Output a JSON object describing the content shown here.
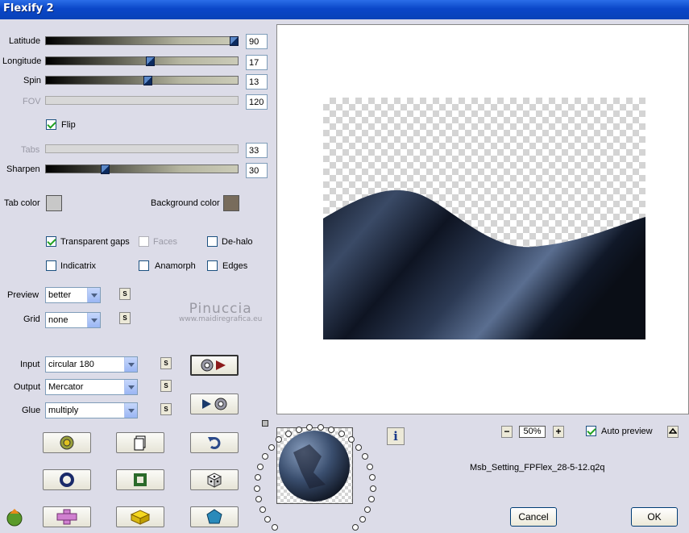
{
  "window": {
    "title": "Flexify 2"
  },
  "sliders": {
    "latitude": {
      "label": "Latitude",
      "value": "90",
      "level": 0.97,
      "enabled": true
    },
    "longitude": {
      "label": "Longitude",
      "value": "17",
      "level": 0.54,
      "enabled": true
    },
    "spin": {
      "label": "Spin",
      "value": "13",
      "level": 0.53,
      "enabled": true
    },
    "fov": {
      "label": "FOV",
      "value": "120",
      "enabled": false
    },
    "tabs": {
      "label": "Tabs",
      "value": "33",
      "enabled": false
    },
    "sharpen": {
      "label": "Sharpen",
      "value": "30",
      "level": 0.31,
      "enabled": true
    }
  },
  "options": {
    "flip": {
      "label": "Flip",
      "checked": true
    },
    "transparent_gaps": {
      "label": "Transparent gaps",
      "checked": true
    },
    "faces": {
      "label": "Faces",
      "checked": false,
      "enabled": false
    },
    "de_halo": {
      "label": "De-halo",
      "checked": false
    },
    "indicatrix": {
      "label": "Indicatrix",
      "checked": false
    },
    "anamorph": {
      "label": "Anamorph",
      "checked": false
    },
    "edges": {
      "label": "Edges",
      "checked": false
    }
  },
  "colors": {
    "tab_color": {
      "label": "Tab color",
      "value": "#c8c8c8"
    },
    "background_color": {
      "label": "Background color",
      "value": "#786c5c"
    }
  },
  "dropdowns": {
    "preview": {
      "label": "Preview",
      "value": "better"
    },
    "grid": {
      "label": "Grid",
      "value": "none"
    },
    "input": {
      "label": "Input",
      "value": "circular 180"
    },
    "output": {
      "label": "Output",
      "value": "Mercator"
    },
    "glue": {
      "label": "Glue",
      "value": "multiply"
    }
  },
  "small_button_label": "S",
  "watermark": {
    "line1": "Pinuccia",
    "line2": "www.maidiregrafica.eu"
  },
  "zoom": {
    "value": "50%",
    "minus": "−",
    "plus": "+"
  },
  "auto_preview": {
    "label": "Auto preview",
    "checked": true
  },
  "info_label": "i",
  "filename": "Msb_Setting_FPFlex_28-5-12.q2q",
  "buttons": {
    "cancel": "Cancel",
    "ok": "OK"
  },
  "icons": {
    "row1": [
      "randomize-icon",
      "copy-icon",
      "undo-icon"
    ],
    "row2": [
      "ring-icon",
      "frame-icon",
      "dice-icon"
    ],
    "row3": [
      "cross-icon",
      "cube-icon",
      "pentagon-icon"
    ]
  }
}
